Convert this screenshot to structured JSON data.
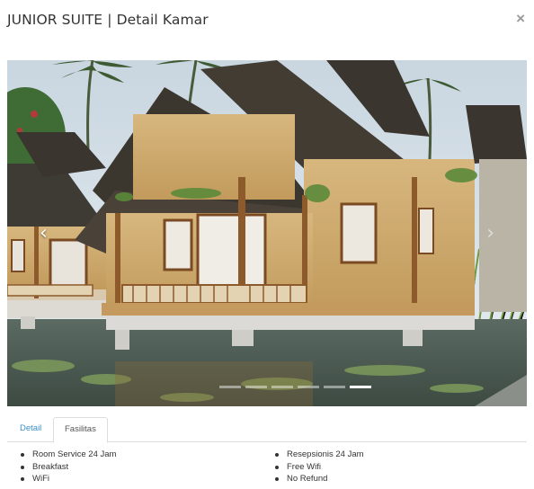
{
  "modal": {
    "title": "JUNIOR SUITE | Detail Kamar",
    "close_label": "×"
  },
  "carousel": {
    "prev_label": "‹",
    "next_label": "›",
    "slide_count": 6,
    "active_slide": 6,
    "image_subject": "bamboo-and-thatch-bungalow-on-stilts-over-lily-pond"
  },
  "tabs": [
    {
      "label": "Detail",
      "active": false
    },
    {
      "label": "Fasilitas",
      "active": true
    }
  ],
  "facilities": {
    "left": [
      "Room Service 24 Jam",
      "Breakfast",
      "WiFi"
    ],
    "right": [
      "Resepsionis 24 Jam",
      "Free Wifi",
      "No Refund"
    ]
  },
  "colors": {
    "link": "#3a8fc9",
    "border": "#dddddd",
    "text": "#333333"
  }
}
